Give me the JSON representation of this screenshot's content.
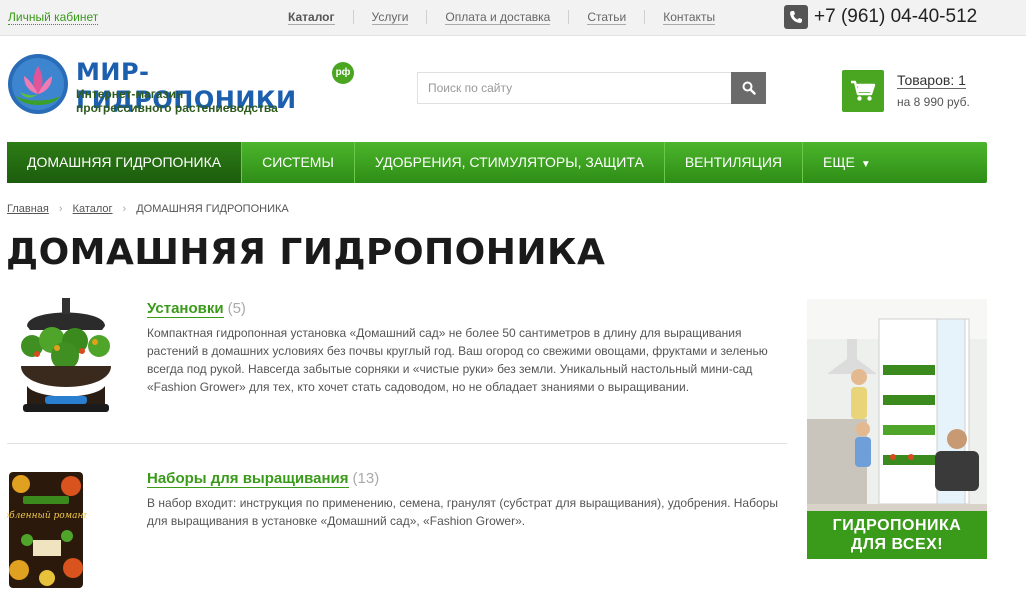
{
  "topbar": {
    "account": "Личный кабинет",
    "nav": [
      "Каталог",
      "Услуги",
      "Оплата и доставка",
      "Статьи",
      "Контакты"
    ],
    "phone": "+7 (961) 04-40-512"
  },
  "header": {
    "logo_title": "МИР-ГИДРОПОНИКИ",
    "logo_rf": "рф",
    "logo_sub_1": "Интернет-магазин",
    "logo_sub_2": "прогрессивного растениеводства",
    "search_placeholder": "Поиск по сайту",
    "cart_count": "Товаров: 1",
    "cart_sum": "на 8 990 руб."
  },
  "mainnav": {
    "items": [
      "Домашняя гидропоника",
      "Системы",
      "Удобрения, стимуляторы, защита",
      "Вентиляция",
      "Еще"
    ]
  },
  "breadcrumb": {
    "home": "Главная",
    "catalog": "Каталог",
    "current": "ДОМАШНЯЯ ГИДРОПОНИКА"
  },
  "page": {
    "title": "ДОМАШНЯЯ ГИДРОПОНИКА"
  },
  "categories": [
    {
      "name": "Установки",
      "count": "(5)",
      "description": "Компактная гидропонная установка «Домашний сад» не более 50 сантиметров в длину для выращивания растений в домашних условиях без почвы круглый год. Ваш огород со свежими овощами, фруктами и зеленью всегда под рукой. Навсегда забытые сорняки и «чистые руки» без земли. Уникальный настольный мини-сад «Fashion Grower» для тех, кто хочет стать садоводом, но не обладает знаниями о выращивании."
    },
    {
      "name": "Наборы для выращивания",
      "count": "(13)",
      "description": "В набор входит: инструкция по применению, семена, гранулят (субстрат для выращивания), удобрения. Наборы для выращивания в установке «Домашний сад», «Fashion Grower».",
      "pack_text": "Влюбленный романтик"
    }
  ],
  "banner": {
    "line1": "ГИДРОПОНИКА",
    "line2": "ДЛЯ ВСЕХ!"
  }
}
